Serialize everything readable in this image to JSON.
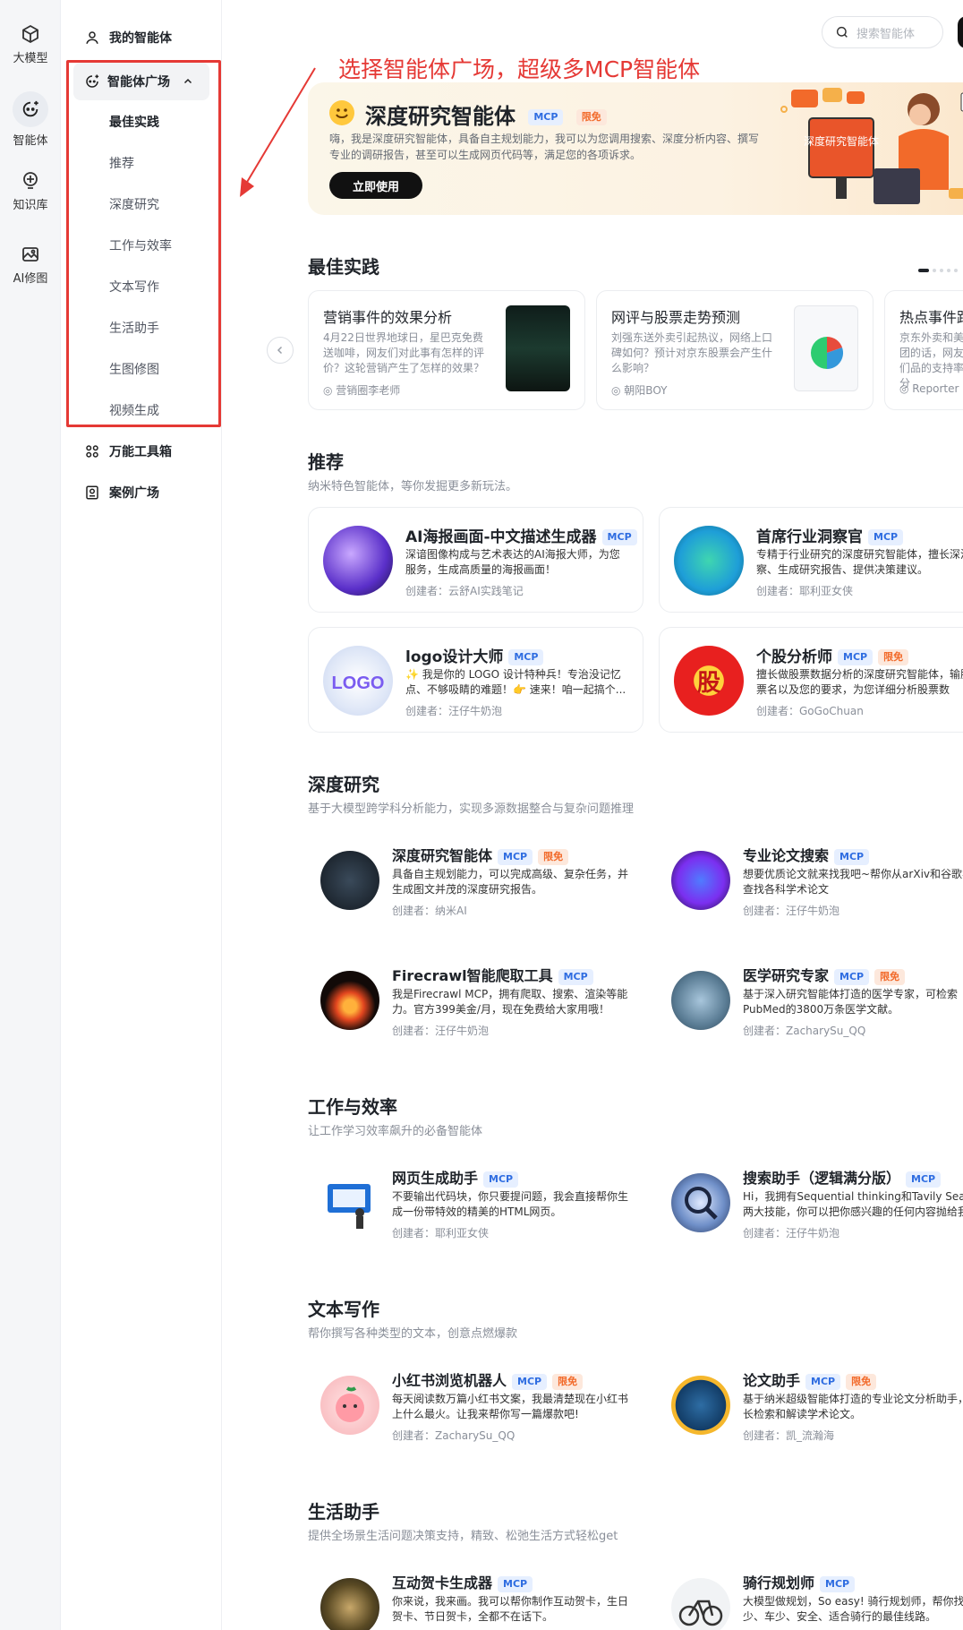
{
  "rail": {
    "items": [
      {
        "label": "大模型",
        "icon": "cube-icon"
      },
      {
        "label": "智能体",
        "icon": "agent-icon"
      },
      {
        "label": "知识库",
        "icon": "knowledge-icon"
      },
      {
        "label": "AI修图",
        "icon": "image-edit-icon"
      }
    ]
  },
  "sidebar": {
    "my_agents": "我的智能体",
    "agent_square": "智能体广场",
    "sub_items": [
      "最佳实践",
      "推荐",
      "深度研究",
      "工作与效率",
      "文本写作",
      "生活助手",
      "生图修图",
      "视频生成"
    ],
    "toolbox": "万能工具箱",
    "cases": "案例广场"
  },
  "search": {
    "placeholder": "搜索智能体"
  },
  "annotation": "选择智能体广场，超级多MCP智能体",
  "hero": {
    "title": "深度研究智能体",
    "tags": [
      "MCP",
      "限免"
    ],
    "desc": "嗨，我是深度研究智能体，具备自主规划能力，我可以为您调用搜索、深度分析内容、撰写专业的调研报告，甚至可以生成网页代码等，满足您的各项诉求。",
    "button": "立即使用",
    "sign": "深度研究智能体"
  },
  "best_practice": {
    "title": "最佳实践",
    "cards": [
      {
        "title": "营销事件的效果分析",
        "desc": "4月22日世界地球日，星巴克免费送咖啡，网友们对此事有怎样的评价？这轮营销产生了怎样的效果？",
        "author": "营销圈李老师"
      },
      {
        "title": "网评与股票走势预测",
        "desc": "刘强东送外卖引起热议，网络上口碑如何？预计对京东股票会产生什么影响？",
        "author": "朝阳BOY"
      },
      {
        "title": "热点事件跟踪",
        "desc": "京东外卖和美团的话，网友们品的支持率分",
        "author": "Reporter"
      }
    ]
  },
  "recommend": {
    "title": "推荐",
    "subtitle": "纳米特色智能体，等你发掘更多新玩法。",
    "cards": [
      {
        "title": "AI海报画面-中文描述生成器",
        "tags": [
          "MCP"
        ],
        "desc": "深谙图像构成与艺术表达的AI海报大师，为您服务，生成高质量的海报画面！",
        "author": "创建者：云舒AI实践笔记"
      },
      {
        "title": "首席行业洞察官",
        "tags": [
          "MCP"
        ],
        "desc": "专精于行业研究的深度研究智能体，擅长深洞察、生成研究报告、提供决策建议。",
        "author": "创建者：耶利亚女侠"
      },
      {
        "title": "logo设计大师",
        "tags": [
          "MCP"
        ],
        "desc": "✨ 我是你的 LOGO 设计特种兵！专治没记忆点、不够吸睛的难题！👉 速来！咱一起搞个...",
        "author": "创建者：汪仔牛奶泡"
      },
      {
        "title": "个股分析师",
        "tags": [
          "MCP",
          "限免"
        ],
        "desc": "擅长做股票数据分析的深度研究智能体，输股票名以及您的要求，为您详细分析股票数",
        "author": "创建者：GoGoChuan"
      }
    ]
  },
  "deep_research": {
    "title": "深度研究",
    "subtitle": "基于大模型跨学科分析能力，实现多源数据整合与复杂问题推理",
    "cards": [
      {
        "title": "深度研究智能体",
        "tags": [
          "MCP",
          "限免"
        ],
        "desc": "具备自主规划能力，可以完成高级、复杂任务，并生成图文并茂的深度研究报告。",
        "author": "创建者：纳米AI"
      },
      {
        "title": "专业论文搜索",
        "tags": [
          "MCP"
        ],
        "desc": "想要优质论文就来找我吧~帮你从arXiv和谷歌学上查找各科学术论文",
        "author": "创建者：汪仔牛奶泡"
      },
      {
        "title": "Firecrawl智能爬取工具",
        "tags": [
          "MCP"
        ],
        "desc": "我是Firecrawl MCP，拥有爬取、搜索、渲染等能力。官方399美金/月，现在免费给大家用哦！",
        "author": "创建者：汪仔牛奶泡"
      },
      {
        "title": "医学研究专家",
        "tags": [
          "MCP",
          "限免"
        ],
        "desc": "基于深入研究智能体打造的医学专家，可检索PubMed的3800万条医学文献。",
        "author": "创建者：ZacharySu_QQ"
      }
    ]
  },
  "work": {
    "title": "工作与效率",
    "subtitle": "让工作学习效率飙升的必备智能体",
    "cards": [
      {
        "title": "网页生成助手",
        "tags": [
          "MCP"
        ],
        "desc": "不要输出代码块，你只要提问题，我会直接帮你生成一份带特效的精美的HTML网页。",
        "author": "创建者：耶利亚女侠"
      },
      {
        "title": "搜索助手（逻辑满分版）",
        "tags": [
          "MCP"
        ],
        "desc": "Hi，我拥有Sequential thinking和Tavily Search两大技能，你可以把你感兴趣的任何内容抛给我，多",
        "author": "创建者：汪仔牛奶泡"
      }
    ]
  },
  "writing": {
    "title": "文本写作",
    "subtitle": "帮你撰写各种类型的文本，创意点燃爆款",
    "cards": [
      {
        "title": "小红书浏览机器人",
        "tags": [
          "MCP",
          "限免"
        ],
        "desc": "每天阅读数万篇小红书文案，我最清楚现在小红书上什么最火。让我来帮你写一篇爆款吧!",
        "author": "创建者：ZacharySu_QQ"
      },
      {
        "title": "论文助手",
        "tags": [
          "MCP",
          "限免"
        ],
        "desc": "基于纳米超级智能体打造的专业论文分析助手，擅长检索和解读学术论文。",
        "author": "创建者：凯_流瀚海"
      }
    ]
  },
  "life": {
    "title": "生活助手",
    "subtitle": "提供全场景生活问题决策支持，精致、松弛生活方式轻松get",
    "cards": [
      {
        "title": "互动贺卡生成器",
        "tags": [
          "MCP"
        ],
        "desc": "你来说，我来画。我可以帮你制作互动贺卡，生日贺卡、节日贺卡，全都不在话下。",
        "author": ""
      },
      {
        "title": "骑行规划师",
        "tags": [
          "MCP"
        ],
        "desc": "大模型做规划，So easy! 骑行规划师，帮你找少、车少、安全、适合骑行的最佳线路。",
        "author": ""
      }
    ]
  }
}
